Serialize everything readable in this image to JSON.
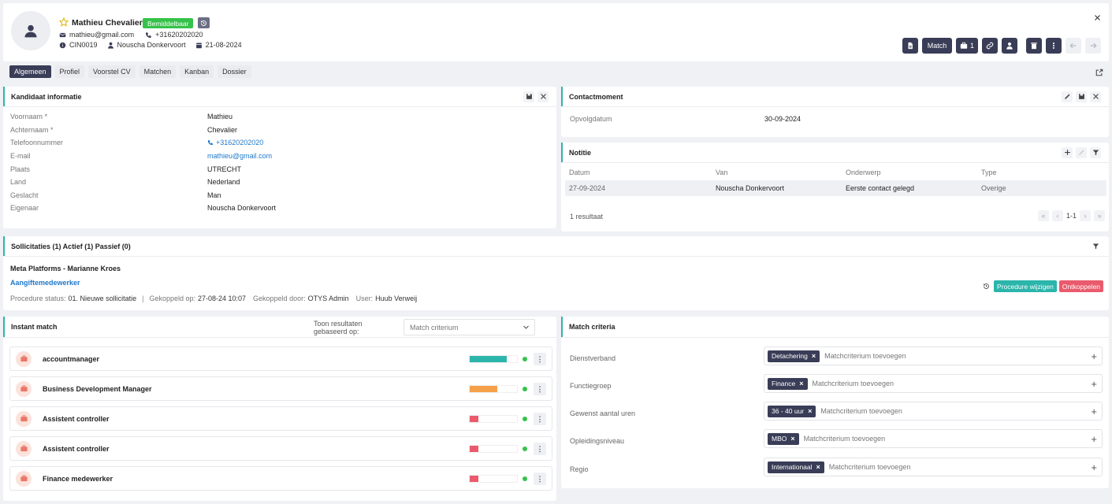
{
  "header": {
    "name": "Mathieu Chevalier",
    "status_badge": "Bemiddelbaar",
    "email": "mathieu@gmail.com",
    "phone": "+31620202020",
    "candidate_id": "CIN0019",
    "owner": "Nouscha Donkervoort",
    "date": "21-08-2024",
    "match_label": "Match",
    "jobs_count": "1"
  },
  "tabs": [
    "Algemeen",
    "Profiel",
    "Voorstel CV",
    "Matchen",
    "Kanban",
    "Dossier"
  ],
  "kandidaat": {
    "title": "Kandidaat informatie",
    "fields": [
      {
        "label": "Voornaam *",
        "value": "Mathieu"
      },
      {
        "label": "Achternaam *",
        "value": "Chevalier"
      },
      {
        "label": "Telefoonnummer",
        "value": "+31620202020"
      },
      {
        "label": "E-mail",
        "value": "mathieu@gmail.com"
      },
      {
        "label": "Plaats",
        "value": "UTRECHT"
      },
      {
        "label": "Land",
        "value": "Nederland"
      },
      {
        "label": "Geslacht",
        "value": "Man"
      },
      {
        "label": "Eigenaar",
        "value": "Nouscha Donkervoort"
      }
    ]
  },
  "contact": {
    "title": "Contactmoment",
    "label": "Opvolgdatum",
    "value": "30-09-2024"
  },
  "notitie": {
    "title": "Notitie",
    "columns": [
      "Datum",
      "Van",
      "Onderwerp",
      "Type"
    ],
    "rows": [
      [
        "27-09-2024",
        "Nouscha Donkervoort",
        "Eerste contact gelegd",
        "Overige"
      ]
    ],
    "result_count": "1 resultaat",
    "pagination": "1-1"
  },
  "sollicitaties": {
    "title": "Sollicitaties (1) Actief (1) Passief (0)",
    "company": "Meta Platforms - Marianne Kroes",
    "job_link": "Aangiftemedewerker",
    "status_label": "Procedure status:",
    "status_value": "01. Nieuwe sollicitatie",
    "linked_on_label": "Gekoppeld op:",
    "linked_on_value": "27-08-24 10:07",
    "linked_by_label": "Gekoppeld door:",
    "linked_by_value": "OTYS Admin",
    "user_label": "User:",
    "user_value": "Huub Verweij",
    "btn_change": "Procedure wijzigen",
    "btn_unlink": "Ontkoppelen"
  },
  "instant_match": {
    "title": "Instant match",
    "based_on_line1": "Toon resultaten",
    "based_on_line2": "gebaseerd op:",
    "select_placeholder": "Match criterium",
    "items": [
      {
        "title": "accountmanager",
        "score": 0.78,
        "color": "#2bb5ab"
      },
      {
        "title": "Business Development Manager",
        "score": 0.58,
        "color": "#f6a14a"
      },
      {
        "title": "Assistent controller",
        "score": 0.18,
        "color": "#e95b6c"
      },
      {
        "title": "Assistent controller",
        "score": 0.18,
        "color": "#e95b6c"
      },
      {
        "title": "Finance medewerker",
        "score": 0.18,
        "color": "#e95b6c"
      }
    ]
  },
  "match_criteria": {
    "title": "Match criteria",
    "placeholder": "Matchcriterium toevoegen",
    "rows": [
      {
        "label": "Dienstverband",
        "chip": "Detachering"
      },
      {
        "label": "Functiegroep",
        "chip": "Finance"
      },
      {
        "label": "Gewenst aantal uren",
        "chip": "36 - 40 uur"
      },
      {
        "label": "Opleidingsniveau",
        "chip": "MBO"
      },
      {
        "label": "Regio",
        "chip": "Internationaal"
      }
    ]
  },
  "colors": {
    "accent": "#2bb5ab",
    "dark": "#3a3d57",
    "badge": "#35c24a",
    "danger": "#e95b6c"
  }
}
